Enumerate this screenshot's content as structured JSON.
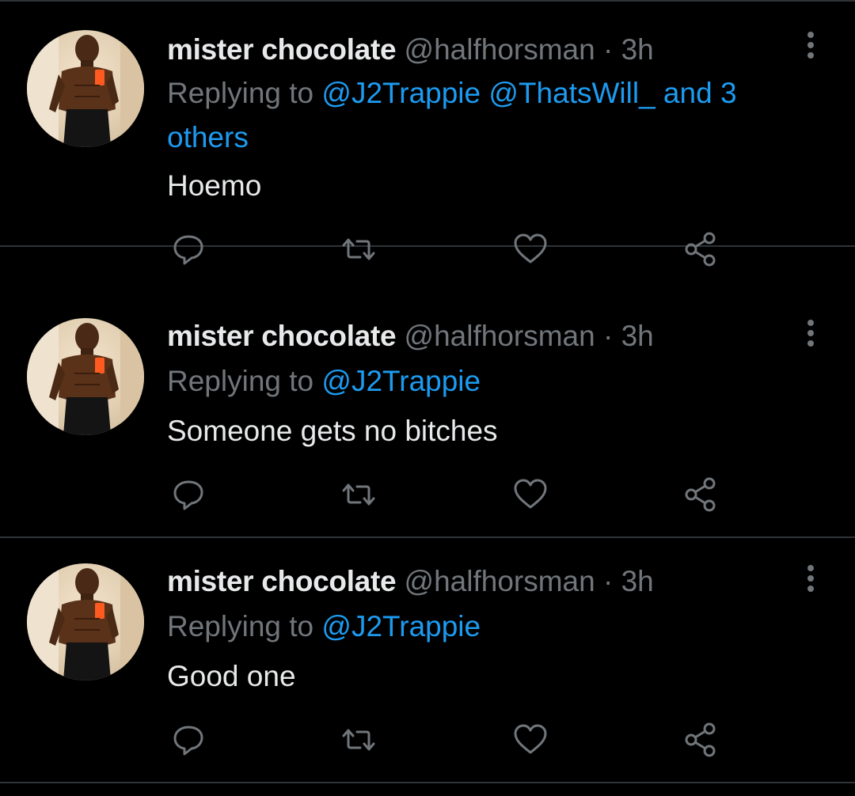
{
  "tweets": [
    {
      "name": "mister chocolate",
      "handle": "@halfhorsman",
      "dot": "·",
      "time": "3h",
      "replying_prefix": "Replying to",
      "mentions": "@J2Trappie @ThatsWill_ and 3 others",
      "text": "Hoemo"
    },
    {
      "name": "mister chocolate",
      "handle": "@halfhorsman",
      "dot": "·",
      "time": "3h",
      "replying_prefix": "Replying to",
      "mentions": "@J2Trappie",
      "text": "Someone gets no bitches"
    },
    {
      "name": "mister chocolate",
      "handle": "@halfhorsman",
      "dot": "·",
      "time": "3h",
      "replying_prefix": "Replying to",
      "mentions": "@J2Trappie",
      "text": "Good one"
    }
  ],
  "icons": {
    "reply": "reply-icon",
    "retweet": "retweet-icon",
    "like": "like-icon",
    "share": "share-icon",
    "more": "more-options-icon"
  },
  "colors": {
    "background": "#000000",
    "primary_text": "#e7e9ea",
    "secondary_text": "#71767b",
    "mention": "#1d9bf0",
    "divider": "#2f3336"
  }
}
